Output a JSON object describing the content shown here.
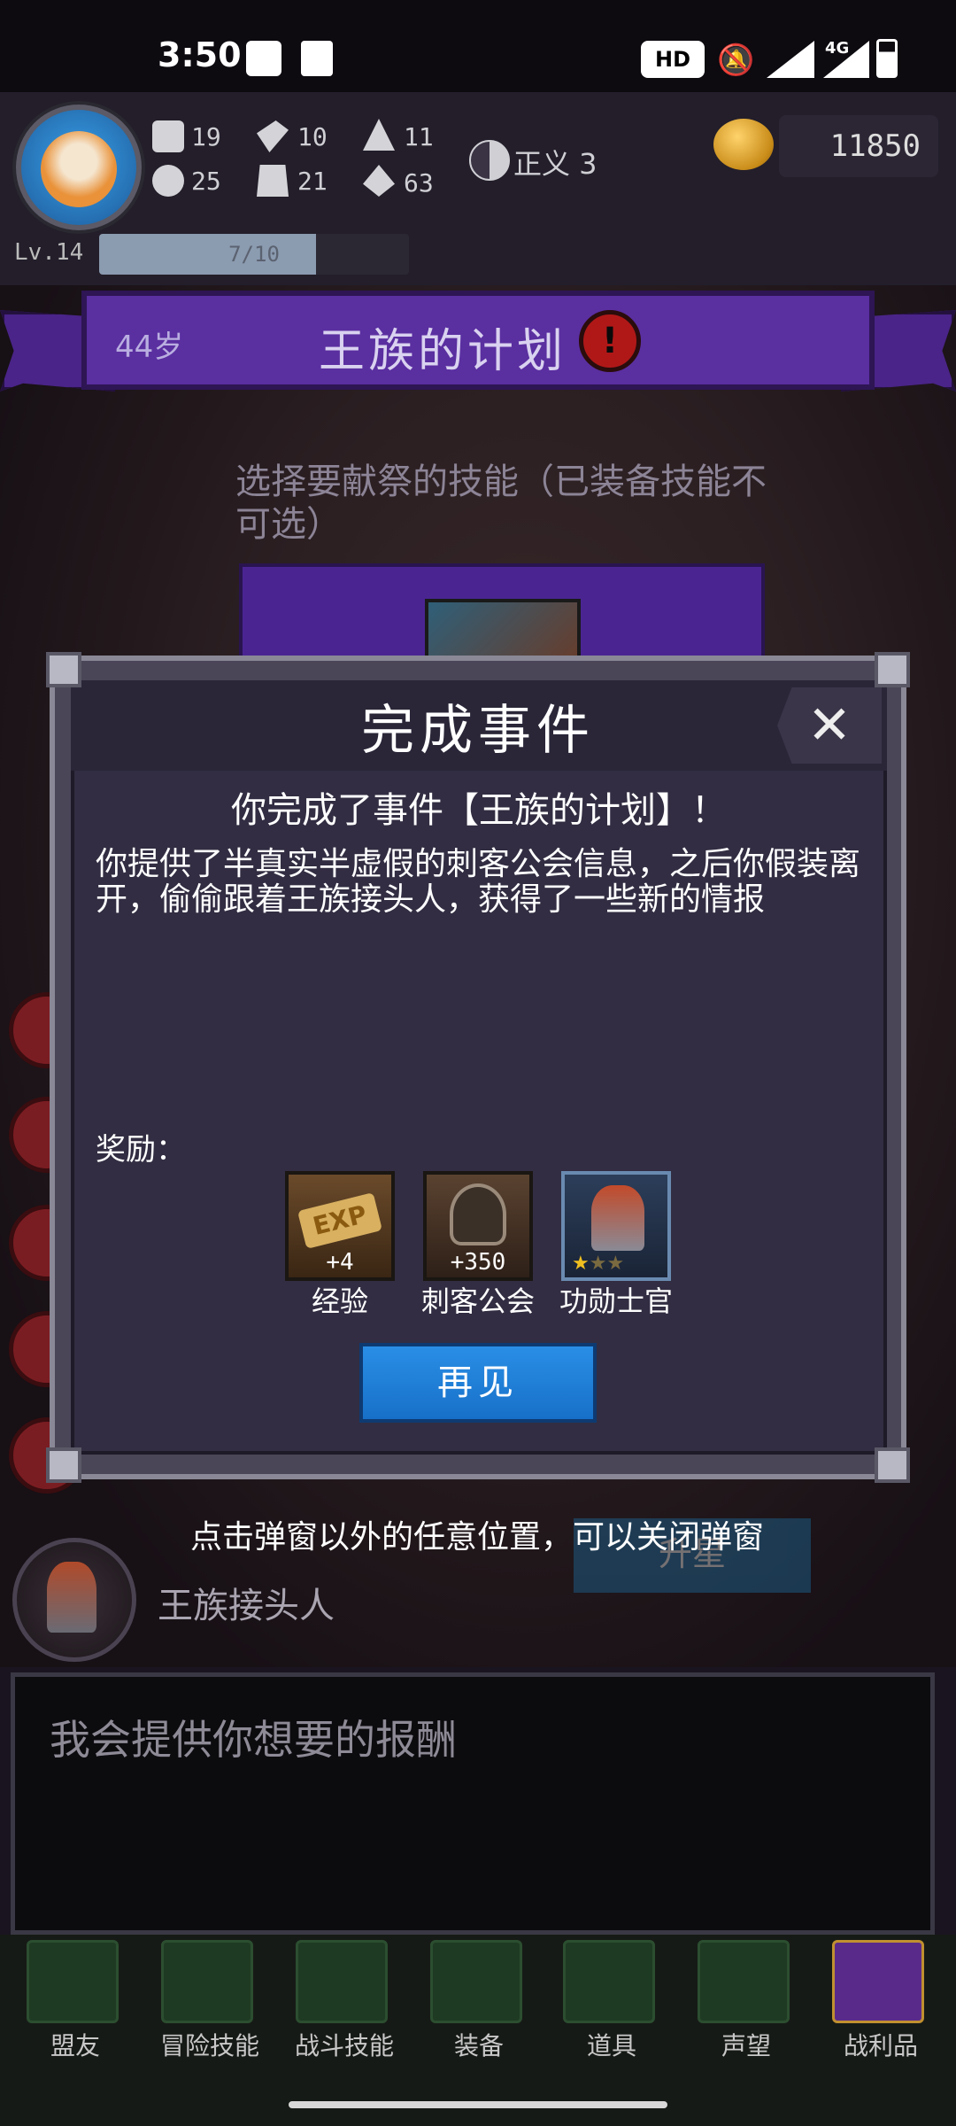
{
  "status_bar": {
    "time": "3:50",
    "network": "4G",
    "hd_label": "HD"
  },
  "hud": {
    "stats": [
      {
        "icon": "fist-icon",
        "value": "19"
      },
      {
        "icon": "hammer-icon",
        "value": "10"
      },
      {
        "icon": "wizard-hat-icon",
        "value": "11"
      },
      {
        "icon": "clover-icon",
        "value": "25"
      },
      {
        "icon": "armor-icon",
        "value": "21"
      },
      {
        "icon": "leaf-sprout-icon",
        "value": "63"
      }
    ],
    "alignment": {
      "icon": "yin-yang-icon",
      "label": "正义 3"
    },
    "gold": "11850",
    "level": "Lv.14",
    "xp_text": "7/10",
    "xp_fraction": 0.7
  },
  "banner": {
    "age": "44岁",
    "event_title": "王族的计划",
    "alert_icon": "!"
  },
  "background": {
    "choose_text": "选择要献祭的技能（已装备技能不可选）"
  },
  "modal": {
    "title": "完成事件",
    "close_icon": "✕",
    "completed_text": "你完成了事件【王族的计划】！",
    "description": "你提供了半真实半虚假的刺客公会信息，之后你假装离开，偷偷跟着王族接头人，获得了一些新的情报",
    "reward_label": "奖励：",
    "rewards": [
      {
        "name": "经验",
        "amount": "+4",
        "icon": "exp-scroll-icon"
      },
      {
        "name": "刺客公会",
        "amount": "+350",
        "icon": "assassin-hood-icon"
      },
      {
        "name": "功勋士官",
        "amount": "",
        "icon": "officer-portrait-icon",
        "stars": 1,
        "max_stars": 3
      }
    ],
    "confirm_label": "再见"
  },
  "hint": "点击弹窗以外的任意位置，可以关闭弹窗",
  "upgrade_label": "升星",
  "npc": {
    "name": "王族接头人",
    "dialog": "我会提供你想要的报酬"
  },
  "nav": [
    {
      "label": "盟友",
      "icon": "handshake-icon"
    },
    {
      "label": "冒险技能",
      "icon": "spellbook-icon"
    },
    {
      "label": "战斗技能",
      "icon": "backpack-icon"
    },
    {
      "label": "装备",
      "icon": "crossed-swords-shield-icon"
    },
    {
      "label": "道具",
      "icon": "pouch-icon"
    },
    {
      "label": "声望",
      "icon": "scroll-icon"
    },
    {
      "label": "战利品",
      "icon": "treasure-chest-icon"
    }
  ],
  "colors": {
    "banner": "#5a2fa0",
    "modal_bg": "#322d42",
    "confirm_button": "#1f80d8",
    "alert": "#b01818"
  }
}
